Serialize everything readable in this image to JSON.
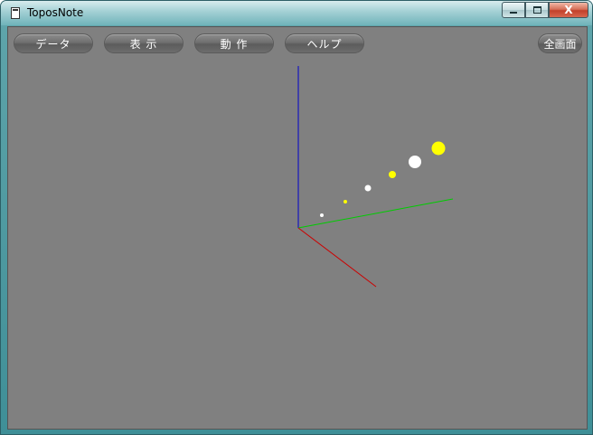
{
  "window": {
    "title": "ToposNote"
  },
  "caption": {
    "minimize": "",
    "maximize": "",
    "close": "X"
  },
  "menu": {
    "data_label": "データ",
    "view_label": "表 示",
    "action_label": "動 作",
    "help_label": "ヘルプ",
    "fullscreen_label": "全画面"
  },
  "colors": {
    "background": "#808080",
    "axis_z": "#0000cc",
    "axis_y": "#00cc00",
    "axis_x": "#cc0000",
    "sphere_white": "#ffffff",
    "sphere_yellow": "#ffff00"
  }
}
